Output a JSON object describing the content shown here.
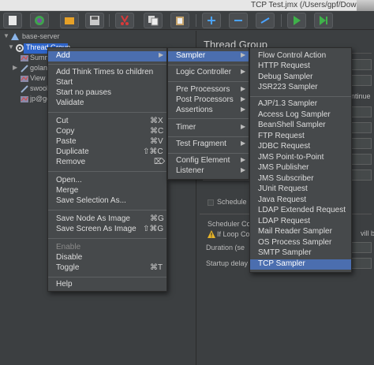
{
  "window": {
    "title": "TCP Test.jmx (/Users/gpf/Downloads/Te"
  },
  "toolbar": {
    "buttons": [
      "new-icon",
      "templates-icon",
      "open-icon",
      "save-icon",
      "cut-icon",
      "copy-icon",
      "paste-icon",
      "add-icon",
      "remove-icon",
      "toggle-icon",
      "start-icon",
      "start-no-pause-icon"
    ]
  },
  "tree": {
    "items": [
      {
        "label": "base-server",
        "icon": "testplan-icon",
        "toggle": "▼"
      },
      {
        "label": "Thread Group",
        "icon": "gear-icon",
        "toggle": "▼"
      },
      {
        "label": "Summ",
        "icon": "listener-icon",
        "toggle": ""
      },
      {
        "label": "golang",
        "icon": "sampler-icon",
        "toggle": "▶"
      },
      {
        "label": "View I",
        "icon": "listener-icon",
        "toggle": ""
      },
      {
        "label": "swool",
        "icon": "sampler-icon",
        "toggle": ""
      },
      {
        "label": "jp@gc",
        "icon": "listener-icon",
        "toggle": ""
      }
    ]
  },
  "panel": {
    "title": "Thread Group",
    "continue_text": "ntinue",
    "will_text": "vill b",
    "scheduler_check": "Schedule",
    "scheduler_config": "Scheduler Co",
    "if_loop": "If Loop Co",
    "duration": "Duration (se",
    "startup_delay": "Startup delay"
  },
  "menu1": {
    "items": [
      {
        "label": "Add",
        "submenu": true,
        "highlighted": true
      },
      {
        "sep": true
      },
      {
        "label": "Add Think Times to children"
      },
      {
        "label": "Start"
      },
      {
        "label": "Start no pauses"
      },
      {
        "label": "Validate"
      },
      {
        "sep": true
      },
      {
        "label": "Cut",
        "shortcut": "⌘X"
      },
      {
        "label": "Copy",
        "shortcut": "⌘C"
      },
      {
        "label": "Paste",
        "shortcut": "⌘V"
      },
      {
        "label": "Duplicate",
        "shortcut": "⇧⌘C"
      },
      {
        "label": "Remove",
        "shortcut": "⌦"
      },
      {
        "sep": true
      },
      {
        "label": "Open..."
      },
      {
        "label": "Merge"
      },
      {
        "label": "Save Selection As..."
      },
      {
        "sep": true
      },
      {
        "label": "Save Node As Image",
        "shortcut": "⌘G"
      },
      {
        "label": "Save Screen As Image",
        "shortcut": "⇧⌘G"
      },
      {
        "sep": true
      },
      {
        "label": "Enable",
        "disabled": true
      },
      {
        "label": "Disable"
      },
      {
        "label": "Toggle",
        "shortcut": "⌘T"
      },
      {
        "sep": true
      },
      {
        "label": "Help"
      }
    ]
  },
  "menu2": {
    "items": [
      {
        "label": "Sampler",
        "submenu": true,
        "highlighted": true
      },
      {
        "sep": true
      },
      {
        "label": "Logic Controller",
        "submenu": true
      },
      {
        "sep": true
      },
      {
        "label": "Pre Processors",
        "submenu": true
      },
      {
        "label": "Post Processors",
        "submenu": true
      },
      {
        "label": "Assertions",
        "submenu": true
      },
      {
        "sep": true
      },
      {
        "label": "Timer",
        "submenu": true
      },
      {
        "sep": true
      },
      {
        "label": "Test Fragment",
        "submenu": true
      },
      {
        "sep": true
      },
      {
        "label": "Config Element",
        "submenu": true
      },
      {
        "label": "Listener",
        "submenu": true
      }
    ]
  },
  "menu3": {
    "items": [
      {
        "label": "Flow Control Action"
      },
      {
        "label": "HTTP Request"
      },
      {
        "label": "Debug Sampler"
      },
      {
        "label": "JSR223 Sampler"
      },
      {
        "sep": true
      },
      {
        "label": "AJP/1.3 Sampler"
      },
      {
        "label": "Access Log Sampler"
      },
      {
        "label": "BeanShell Sampler"
      },
      {
        "label": "FTP Request"
      },
      {
        "label": "JDBC Request"
      },
      {
        "label": "JMS Point-to-Point"
      },
      {
        "label": "JMS Publisher"
      },
      {
        "label": "JMS Subscriber"
      },
      {
        "label": "JUnit Request"
      },
      {
        "label": "Java Request"
      },
      {
        "label": "LDAP Extended Request"
      },
      {
        "label": "LDAP Request"
      },
      {
        "label": "Mail Reader Sampler"
      },
      {
        "label": "OS Process Sampler"
      },
      {
        "label": "SMTP Sampler"
      },
      {
        "label": "TCP Sampler",
        "highlighted": true
      }
    ]
  },
  "colors": {
    "background": "#3c3f41",
    "menu_bg": "#46494b",
    "highlight": "#4b6eaf",
    "selection": "#2f65ca"
  }
}
